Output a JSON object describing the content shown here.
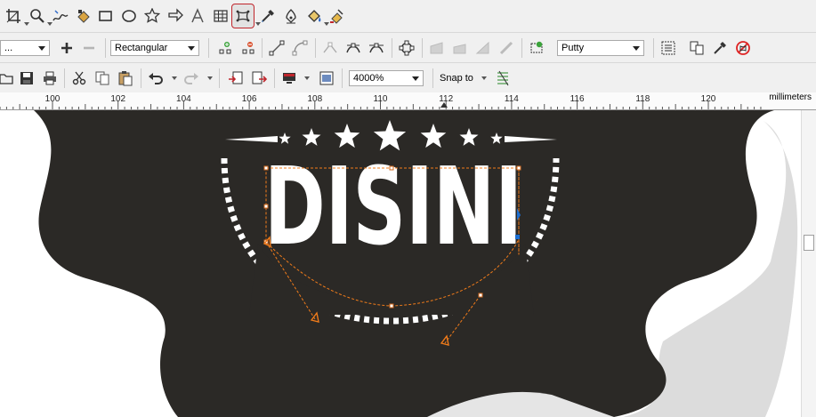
{
  "toolbox": {
    "tools": [
      {
        "name": "crop-icon"
      },
      {
        "name": "zoom-icon"
      },
      {
        "name": "freehand-icon"
      },
      {
        "name": "smart-fill-icon"
      },
      {
        "name": "rectangle-icon"
      },
      {
        "name": "ellipse-icon"
      },
      {
        "name": "star-icon"
      },
      {
        "name": "basic-shapes-icon"
      },
      {
        "name": "text-icon"
      },
      {
        "name": "table-icon"
      },
      {
        "name": "envelope-icon"
      },
      {
        "name": "eyedropper-icon"
      },
      {
        "name": "pen-nib-icon"
      },
      {
        "name": "fill-bucket-icon"
      },
      {
        "name": "interactive-fill-icon"
      }
    ],
    "active_tool": "envelope-icon"
  },
  "property_bar": {
    "preset_value": "...",
    "mode_value": "Rectangular",
    "envelope_mode_value": "Putty"
  },
  "standard_bar": {
    "zoom_value": "4000%",
    "snap_label": "Snap to"
  },
  "ruler": {
    "unit": "millimeters",
    "ticks": [
      "100",
      "102",
      "104",
      "106",
      "108",
      "110",
      "112",
      "114",
      "116",
      "118",
      "120"
    ]
  },
  "canvas": {
    "artwork_text": "DISINI",
    "colors": {
      "badge": "#2b2926",
      "artwork": "#ffffff",
      "envelope": "#f07b1a",
      "shadow": "#dcdcdc"
    }
  }
}
